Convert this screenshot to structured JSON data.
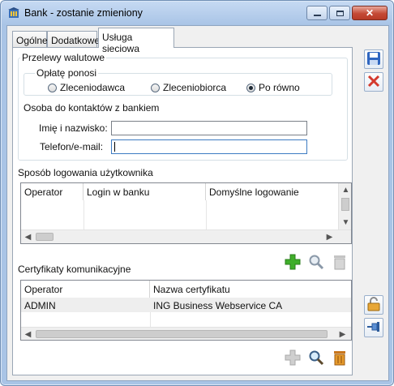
{
  "window": {
    "title": "Bank - zostanie zmieniony"
  },
  "tabs": [
    {
      "label": "Ogólne",
      "active": false
    },
    {
      "label": "Dodatkowe",
      "active": false
    },
    {
      "label": "Usługa sieciowa",
      "active": true
    }
  ],
  "transfers": {
    "group_label": "Przelewy walutowe",
    "fees": {
      "label": "Opłatę ponosi",
      "options": [
        {
          "label": "Zleceniodawca",
          "selected": false
        },
        {
          "label": "Zleceniobiorca",
          "selected": false
        },
        {
          "label": "Po równo",
          "selected": true
        }
      ]
    },
    "contact": {
      "label": "Osoba do kontaktów z bankiem",
      "name_label": "Imię i nazwisko:",
      "name_value": "",
      "phone_label": "Telefon/e-mail:",
      "phone_value": ""
    }
  },
  "login_section": {
    "label": "Sposób logowania użytkownika",
    "columns": [
      "Operator",
      "Login w banku",
      "Domyślne logowanie"
    ],
    "rows": []
  },
  "certificates": {
    "label": "Certyfikaty komunikacyjne",
    "columns": [
      "Operator",
      "Nazwa certyfikatu"
    ],
    "rows": [
      {
        "operator": "ADMIN",
        "name": "ING Business Webservice CA"
      }
    ]
  },
  "icons": {
    "save": "floppy-disk-icon",
    "cancel": "red-x-icon",
    "add": "green-plus-icon",
    "view": "magnifier-icon",
    "delete": "trash-icon",
    "lock": "padlock-icon",
    "pin": "pin-icon"
  },
  "colors": {
    "title_gradient": "#b9d1ee",
    "close_button": "#c44a35",
    "add_green": "#3fae2a",
    "cancel_red": "#d43a2e",
    "focus_border": "#3d7bc2"
  }
}
